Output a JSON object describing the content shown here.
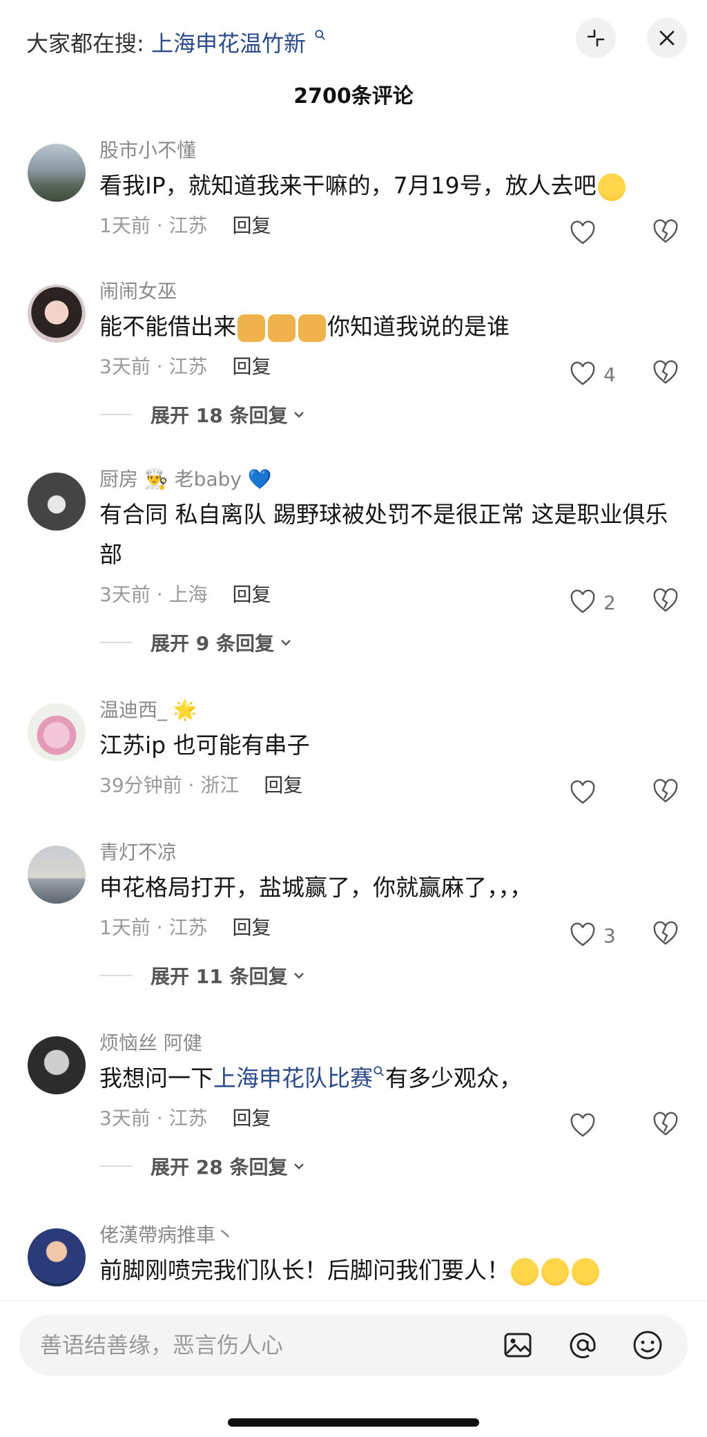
{
  "header": {
    "search_prefix": "大家都在搜:",
    "search_keyword": "上海申花温竹新",
    "comment_count": "2700条评论"
  },
  "comments": [
    {
      "username": "股市小不懂",
      "text": "看我IP，就知道我来干嘛的，7月19号，放人去吧",
      "time_location": "1天前 · 江苏",
      "reply_label": "回复",
      "likes": ""
    },
    {
      "username": "闹闹女巫",
      "text_before": "能不能借出来",
      "text_after": "你知道我说的是谁",
      "time_location": "3天前 · 江苏",
      "reply_label": "回复",
      "likes": "4",
      "expand_label": "展开 18 条回复"
    },
    {
      "username": "厨房 👨‍🍳 老baby 💙",
      "text": "有合同 私自离队 踢野球被处罚不是很正常 这是职业俱乐部",
      "time_location": "3天前 · 上海",
      "reply_label": "回复",
      "likes": "2",
      "expand_label": "展开 9 条回复"
    },
    {
      "username": "温迪西_ 🌟",
      "text": "江苏ip 也可能有串子",
      "time_location": "39分钟前 · 浙江",
      "reply_label": "回复",
      "likes": ""
    },
    {
      "username": "青灯不凉",
      "text": "申花格局打开，盐城赢了，你就赢麻了，，，",
      "time_location": "1天前 · 江苏",
      "reply_label": "回复",
      "likes": "3",
      "expand_label": "展开 11 条回复"
    },
    {
      "username": "烦恼丝 阿健",
      "text_before": "我想问一下",
      "text_keyword": "上海申花队比赛",
      "text_after": "有多少观众，",
      "time_location": "3天前 · 江苏",
      "reply_label": "回复",
      "likes": "",
      "expand_label": "展开 28 条回复"
    },
    {
      "username": "佬漢帶病推車丶",
      "text": "前脚刚喷完我们队长！后脚问我们要人！",
      "likes": ""
    }
  ],
  "input": {
    "placeholder": "善语结善缘，恶言伤人心"
  },
  "colors": {
    "keyword": "#2a4a8a",
    "meta": "#9a9a9a"
  },
  "icons": [
    "search-icon",
    "collapse-icon",
    "close-icon",
    "heart-icon",
    "broken-heart-icon",
    "chevron-down-icon",
    "image-icon",
    "at-icon",
    "emoji-icon"
  ]
}
